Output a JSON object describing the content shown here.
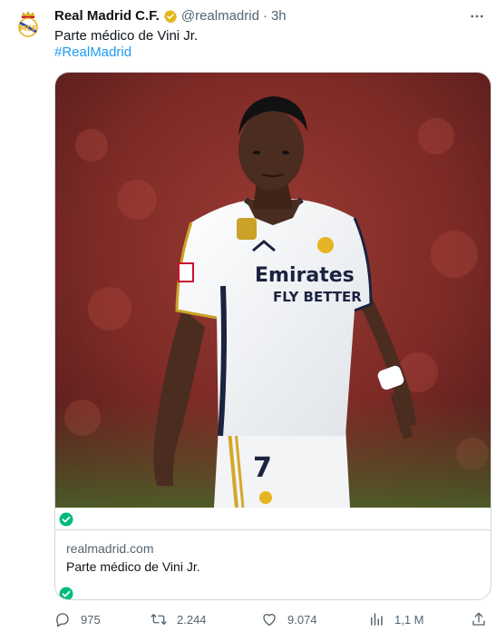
{
  "author": {
    "name": "Real Madrid C.F.",
    "handle": "@realmadrid",
    "separator": "·",
    "time": "3h",
    "avatar_icon": "real-madrid-crest-icon",
    "verified_icon": "gold-verified-badge-icon"
  },
  "tweet": {
    "text": "Parte médico de Vini Jr.",
    "hashtag": "#RealMadrid"
  },
  "card": {
    "image_icon": "player-photo",
    "domain": "realmadrid.com",
    "title": "Parte médico de Vini Jr.",
    "check_icon": "green-check-icon"
  },
  "actions": {
    "replies": "975",
    "retweets": "2.244",
    "likes": "9.074",
    "views": "1,1 M",
    "reply_icon": "reply-icon",
    "retweet_icon": "retweet-icon",
    "like_icon": "heart-icon",
    "views_icon": "analytics-icon",
    "share_icon": "share-icon"
  },
  "colors": {
    "text": "#0f1419",
    "secondary": "#536471",
    "link": "#1d9bf0",
    "border": "#cfd9de",
    "verified_gold": "#e2b719",
    "check_green": "#00ba7c"
  }
}
